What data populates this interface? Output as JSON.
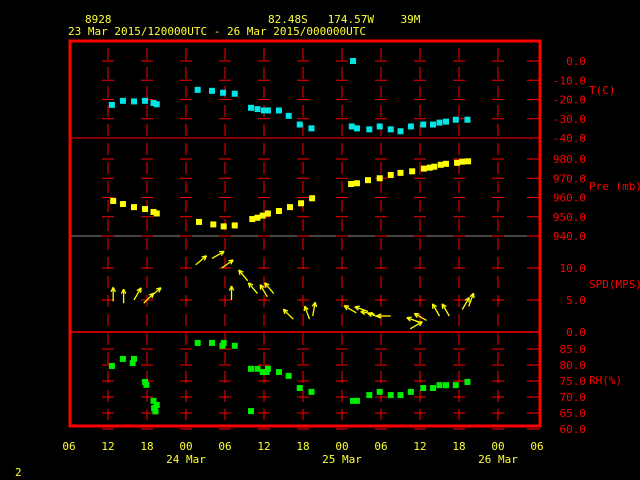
{
  "header": {
    "station_id": "8928",
    "location": "82.48S   174.57W    39M",
    "period": "23 Mar 2015/120000UTC - 26 Mar 2015/000000UTC"
  },
  "page_number": "2",
  "colors": {
    "frame": "#ff0000",
    "text": "#ffff33",
    "temperature": "#00e5e5",
    "pressure": "#ffff00",
    "wind": "#ffff00",
    "rh": "#00ee00"
  },
  "chart_data": {
    "type": "scatter",
    "title": "8928 82.48S 174.57W 39M",
    "x_unit": "hours since 23 Mar 2015 00UTC",
    "xlim": [
      6,
      78
    ],
    "x_tick_labels": [
      "06",
      "12",
      "18",
      "00",
      "06",
      "12",
      "18",
      "00",
      "06",
      "12",
      "18",
      "00",
      "06"
    ],
    "date_labels": [
      {
        "hour": 24,
        "label": "24 Mar"
      },
      {
        "hour": 48,
        "label": "25 Mar"
      },
      {
        "hour": 72,
        "label": "26 Mar"
      }
    ],
    "panels": [
      {
        "name": "temperature",
        "label": "T(C)",
        "ylim": [
          -40,
          10
        ],
        "ticks": [
          {
            "v": 0,
            "t": "0.0"
          },
          {
            "v": -10,
            "t": "-10.0"
          },
          {
            "v": -20,
            "t": "-20.0"
          },
          {
            "v": -30,
            "t": "-30.0"
          },
          {
            "v": -40,
            "t": "-40.0"
          }
        ],
        "points": [
          [
            12.6,
            -22.8
          ],
          [
            14.3,
            -20.7
          ],
          [
            16,
            -21
          ],
          [
            17.7,
            -20.7
          ],
          [
            19,
            -21.8
          ],
          [
            19.5,
            -22.5
          ],
          [
            25.8,
            -15
          ],
          [
            28,
            -15.5
          ],
          [
            29.7,
            -16.5
          ],
          [
            31.5,
            -17
          ],
          [
            34,
            -24.3
          ],
          [
            35,
            -25
          ],
          [
            36,
            -25.7
          ],
          [
            36.6,
            -25.7
          ],
          [
            38.3,
            -25.7
          ],
          [
            39.8,
            -28.5
          ],
          [
            41.5,
            -33
          ],
          [
            43.3,
            -35
          ],
          [
            49.7,
            0
          ],
          [
            49.5,
            -34
          ],
          [
            50.3,
            -35
          ],
          [
            52.2,
            -35.5
          ],
          [
            53.8,
            -34
          ],
          [
            55.5,
            -35.5
          ],
          [
            57,
            -36.5
          ],
          [
            58.6,
            -34
          ],
          [
            60.5,
            -33
          ],
          [
            62,
            -33
          ],
          [
            63,
            -32
          ],
          [
            64,
            -31.5
          ],
          [
            65.5,
            -30.5
          ],
          [
            67.3,
            -30.5
          ]
        ]
      },
      {
        "name": "pressure",
        "label": "Pre (mb)",
        "ylim": [
          940,
          990
        ],
        "ticks": [
          {
            "v": 980,
            "t": "980.0"
          },
          {
            "v": 970,
            "t": "970.0"
          },
          {
            "v": 960,
            "t": "960.0"
          },
          {
            "v": 950,
            "t": "950.0"
          },
          {
            "v": 940,
            "t": "940.0"
          }
        ],
        "points": [
          [
            12.8,
            958.2
          ],
          [
            14.3,
            956.6
          ],
          [
            16,
            955
          ],
          [
            17.7,
            954
          ],
          [
            19,
            952.5
          ],
          [
            19.5,
            951.7
          ],
          [
            26,
            947.3
          ],
          [
            28.2,
            946
          ],
          [
            29.8,
            945
          ],
          [
            31.5,
            945.5
          ],
          [
            34.2,
            948.8
          ],
          [
            35,
            949.5
          ],
          [
            35.8,
            950.6
          ],
          [
            36.6,
            951.7
          ],
          [
            38.3,
            953
          ],
          [
            40,
            955
          ],
          [
            41.7,
            957
          ],
          [
            43.4,
            959.6
          ],
          [
            49.4,
            967
          ],
          [
            50.3,
            967.4
          ],
          [
            52,
            969
          ],
          [
            53.8,
            970
          ],
          [
            55.5,
            971.7
          ],
          [
            57,
            972.8
          ],
          [
            58.8,
            973.6
          ],
          [
            60.6,
            975
          ],
          [
            61.5,
            975.5
          ],
          [
            62.2,
            976
          ],
          [
            63.2,
            977
          ],
          [
            64,
            977.5
          ],
          [
            65.7,
            978
          ],
          [
            66.5,
            978.6
          ],
          [
            67.4,
            978.8
          ]
        ]
      },
      {
        "name": "wind",
        "label": "SPD(MPS)",
        "ylim": [
          0,
          15
        ],
        "ticks": [
          {
            "v": 10,
            "t": "10.0"
          },
          {
            "v": 5,
            "t": "5.0"
          },
          {
            "v": 0,
            "t": "0.0"
          }
        ],
        "points": [
          [
            12.8,
            4.8,
            0
          ],
          [
            14.4,
            4.5,
            0
          ],
          [
            16,
            5,
            30
          ],
          [
            17.5,
            4.5,
            45
          ],
          [
            18.5,
            5.5,
            50
          ],
          [
            25.5,
            10.5,
            50
          ],
          [
            28,
            11.5,
            60
          ],
          [
            29.5,
            10,
            55
          ],
          [
            31,
            5,
            0
          ],
          [
            33.5,
            8,
            -40
          ],
          [
            35,
            6,
            -40
          ],
          [
            36.5,
            5.5,
            -30
          ],
          [
            37.5,
            6,
            -40
          ],
          [
            40.5,
            2,
            -45
          ],
          [
            43,
            2,
            -20
          ],
          [
            43.5,
            2.5,
            10
          ],
          [
            50.2,
            3,
            -60
          ],
          [
            52,
            3.2,
            -70
          ],
          [
            53,
            2.8,
            -80
          ],
          [
            54,
            2.2,
            -70
          ],
          [
            55.5,
            2.5,
            -90
          ],
          [
            58.5,
            0.5,
            60
          ],
          [
            60,
            1.5,
            -70
          ],
          [
            61,
            1.8,
            -60
          ],
          [
            63,
            2.5,
            -30
          ],
          [
            64.5,
            2.5,
            -30
          ],
          [
            66.5,
            3.5,
            30
          ],
          [
            67.5,
            4,
            20
          ]
        ]
      },
      {
        "name": "rh",
        "label": "RH(%)",
        "ylim": [
          60,
          90
        ],
        "ticks": [
          {
            "v": 85,
            "t": "85.0"
          },
          {
            "v": 80,
            "t": "80.0"
          },
          {
            "v": 75,
            "t": "75.0"
          },
          {
            "v": 70,
            "t": "70.0"
          },
          {
            "v": 65,
            "t": "65.0"
          },
          {
            "v": 60,
            "t": "60.0"
          }
        ],
        "points": [
          [
            12.6,
            79.7
          ],
          [
            14.3,
            81.9
          ],
          [
            16,
            81.9
          ],
          [
            15.8,
            80.6
          ],
          [
            17.7,
            74.7
          ],
          [
            17.9,
            73.8
          ],
          [
            19,
            68.8
          ],
          [
            19.5,
            67.5
          ],
          [
            19.1,
            66.5
          ],
          [
            19.3,
            65.5
          ],
          [
            25.8,
            86.9
          ],
          [
            28,
            86.9
          ],
          [
            29.8,
            86.9
          ],
          [
            29.6,
            86
          ],
          [
            31.5,
            86
          ],
          [
            34,
            78.8
          ],
          [
            35,
            78.8
          ],
          [
            35.8,
            77.8
          ],
          [
            36.6,
            78.8
          ],
          [
            36.4,
            77.8
          ],
          [
            38.3,
            77.8
          ],
          [
            39.8,
            76.6
          ],
          [
            41.5,
            72.8
          ],
          [
            43.3,
            71.6
          ],
          [
            34,
            65.6
          ],
          [
            49.7,
            68.8
          ],
          [
            50.3,
            68.8
          ],
          [
            52.2,
            70.6
          ],
          [
            53.8,
            71.6
          ],
          [
            55.5,
            70.6
          ],
          [
            57,
            70.6
          ],
          [
            58.6,
            71.6
          ],
          [
            60.5,
            72.8
          ],
          [
            62,
            72.8
          ],
          [
            63,
            73.7
          ],
          [
            64,
            73.7
          ],
          [
            65.5,
            73.7
          ],
          [
            67.3,
            74.7
          ]
        ]
      }
    ]
  }
}
